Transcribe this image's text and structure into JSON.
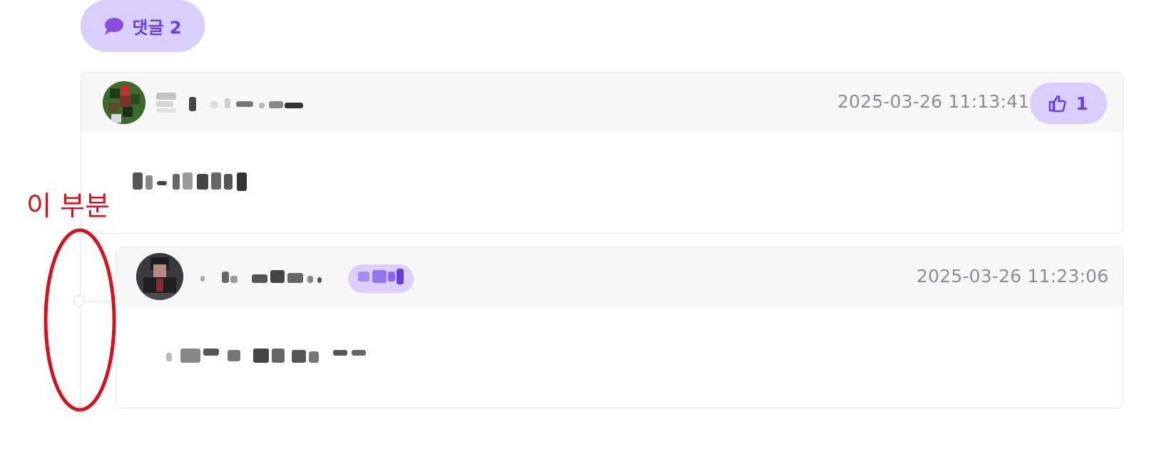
{
  "comments_header": {
    "icon": "chat-bubble-icon",
    "label": "댓글 2"
  },
  "comments": [
    {
      "author": "[blurred name]",
      "timestamp": "2025-03-26 11:13:41",
      "likes": "1",
      "body": "[blurred text]",
      "avatar_color": "#3a6b2a"
    },
    {
      "author": "[blurred name]",
      "badge": "[blurred badge]",
      "timestamp": "2025-03-26 11:23:06",
      "body": "[blurred text]",
      "avatar_color": "#2b2b2e"
    }
  ],
  "annotation": {
    "label": "이 부분",
    "color": "#d2141e"
  },
  "colors": {
    "accent": "#6a3fd9",
    "accent_bg": "#d9cffd",
    "header_bg": "#f7f7f7",
    "border": "#e8e8ea",
    "muted_text": "#8d8d8f"
  }
}
